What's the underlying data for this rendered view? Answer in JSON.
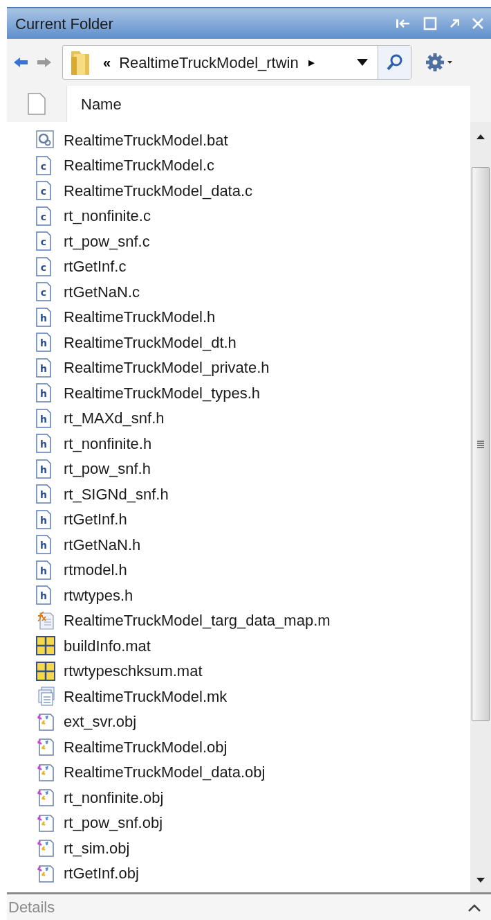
{
  "panel": {
    "title": "Current Folder"
  },
  "address": {
    "prefix": "«",
    "path": "RealtimeTruckModel_rtwin",
    "separator": "▸"
  },
  "columns": [
    "Name"
  ],
  "files": [
    {
      "name": "RealtimeTruckModel.bat",
      "kind": "bat"
    },
    {
      "name": "RealtimeTruckModel.c",
      "kind": "c"
    },
    {
      "name": "RealtimeTruckModel_data.c",
      "kind": "c"
    },
    {
      "name": "rt_nonfinite.c",
      "kind": "c"
    },
    {
      "name": "rt_pow_snf.c",
      "kind": "c"
    },
    {
      "name": "rtGetInf.c",
      "kind": "c"
    },
    {
      "name": "rtGetNaN.c",
      "kind": "c"
    },
    {
      "name": "RealtimeTruckModel.h",
      "kind": "h"
    },
    {
      "name": "RealtimeTruckModel_dt.h",
      "kind": "h"
    },
    {
      "name": "RealtimeTruckModel_private.h",
      "kind": "h"
    },
    {
      "name": "RealtimeTruckModel_types.h",
      "kind": "h"
    },
    {
      "name": "rt_MAXd_snf.h",
      "kind": "h"
    },
    {
      "name": "rt_nonfinite.h",
      "kind": "h"
    },
    {
      "name": "rt_pow_snf.h",
      "kind": "h"
    },
    {
      "name": "rt_SIGNd_snf.h",
      "kind": "h"
    },
    {
      "name": "rtGetInf.h",
      "kind": "h"
    },
    {
      "name": "rtGetNaN.h",
      "kind": "h"
    },
    {
      "name": "rtmodel.h",
      "kind": "h"
    },
    {
      "name": "rtwtypes.h",
      "kind": "h"
    },
    {
      "name": "RealtimeTruckModel_targ_data_map.m",
      "kind": "m"
    },
    {
      "name": "buildInfo.mat",
      "kind": "mat"
    },
    {
      "name": "rtwtypeschksum.mat",
      "kind": "mat"
    },
    {
      "name": "RealtimeTruckModel.mk",
      "kind": "mk"
    },
    {
      "name": "ext_svr.obj",
      "kind": "obj"
    },
    {
      "name": "RealtimeTruckModel.obj",
      "kind": "obj"
    },
    {
      "name": "RealtimeTruckModel_data.obj",
      "kind": "obj"
    },
    {
      "name": "rt_nonfinite.obj",
      "kind": "obj"
    },
    {
      "name": "rt_pow_snf.obj",
      "kind": "obj"
    },
    {
      "name": "rt_sim.obj",
      "kind": "obj"
    },
    {
      "name": "rtGetInf.obj",
      "kind": "obj"
    }
  ],
  "details": {
    "title": "Details"
  }
}
